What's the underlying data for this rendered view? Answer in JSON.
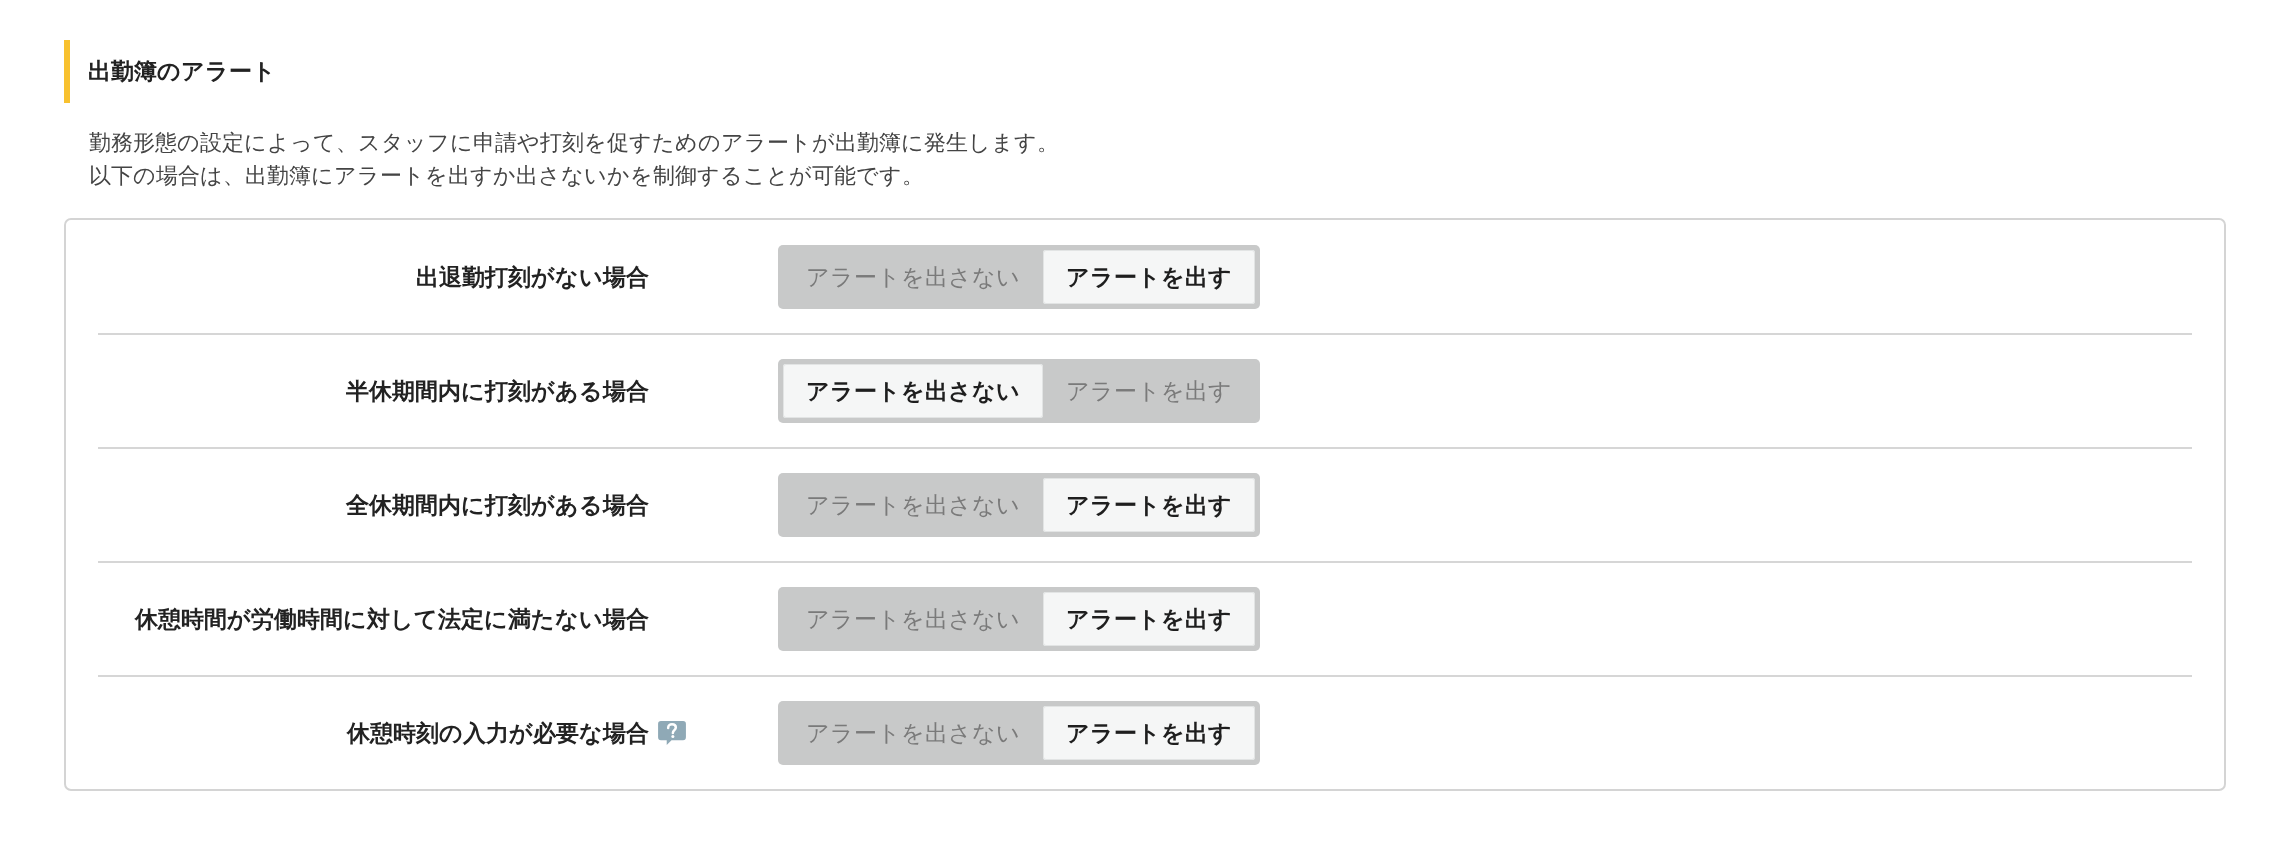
{
  "section": {
    "title": "出勤簿のアラート",
    "description": [
      "勤務形態の設定によって、スタッフに申請や打刻を促すためのアラートが出勤簿に発生します。",
      "以下の場合は、出勤簿にアラートを出すか出さないかを制御することが可能です。"
    ]
  },
  "settings": [
    {
      "label": "出退勤打刻がない場合",
      "help": false,
      "options": [
        {
          "label": "アラートを出さない",
          "selected": false
        },
        {
          "label": "アラートを出す",
          "selected": true
        }
      ]
    },
    {
      "label": "半休期間内に打刻がある場合",
      "help": false,
      "options": [
        {
          "label": "アラートを出さない",
          "selected": true
        },
        {
          "label": "アラートを出す",
          "selected": false
        }
      ]
    },
    {
      "label": "全休期間内に打刻がある場合",
      "help": false,
      "options": [
        {
          "label": "アラートを出さない",
          "selected": false
        },
        {
          "label": "アラートを出す",
          "selected": true
        }
      ]
    },
    {
      "label": "休憩時間が労働時間に対して法定に満たない場合",
      "help": false,
      "options": [
        {
          "label": "アラートを出さない",
          "selected": false
        },
        {
          "label": "アラートを出す",
          "selected": true
        }
      ]
    },
    {
      "label": "休憩時刻の入力が必要な場合",
      "help": true,
      "options": [
        {
          "label": "アラートを出さない",
          "selected": false
        },
        {
          "label": "アラートを出す",
          "selected": true
        }
      ]
    }
  ]
}
